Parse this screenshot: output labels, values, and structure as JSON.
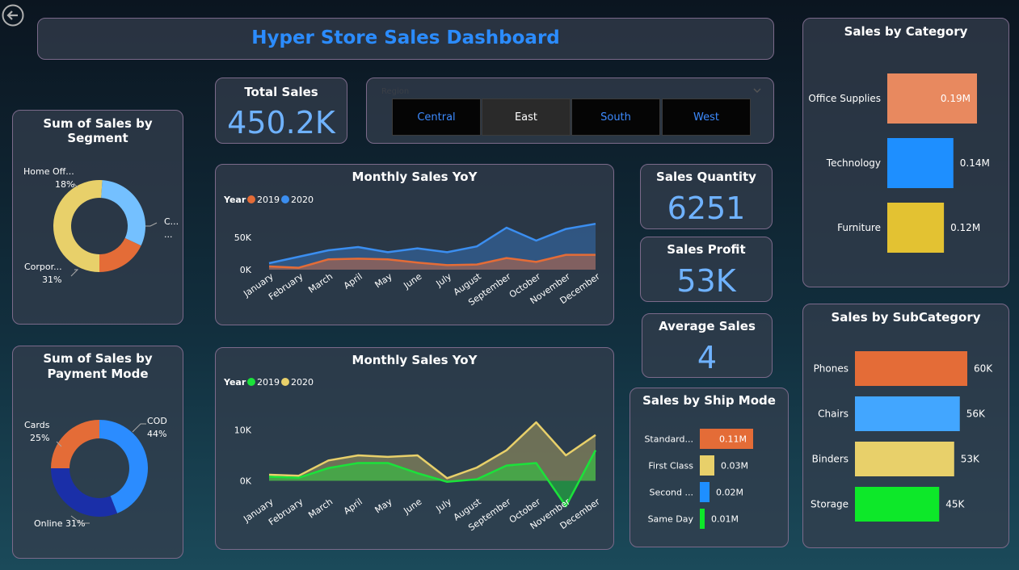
{
  "header": {
    "title": "Hyper Store Sales Dashboard"
  },
  "kpis": {
    "total_sales": {
      "label": "Total Sales",
      "value": "450.2K"
    },
    "quantity": {
      "label": "Sales Quantity",
      "value": "6251"
    },
    "profit": {
      "label": "Sales Profit",
      "value": "53K"
    },
    "avg": {
      "label": "Average Sales",
      "value": "4"
    }
  },
  "region_slicer": {
    "label": "Region",
    "options": [
      "Central",
      "East",
      "South",
      "West"
    ],
    "selected": "East"
  },
  "colors": {
    "orange": "#e46c37",
    "blue": "#3b8ef0",
    "yellow": "#e8d06a",
    "green": "#1be23a",
    "darkblue": "#1a2fa8",
    "lightblue": "#74c0ff",
    "accent": "#2b8cff"
  },
  "chart_data": [
    {
      "id": "segment",
      "type": "pie",
      "title": "Sum of Sales by Segment",
      "slices": [
        {
          "label": "C...",
          "value": 51,
          "pct_label": "...",
          "color": "#e8d06a"
        },
        {
          "label": "Corpor...",
          "value": 31,
          "pct_label": "31%",
          "color": "#74c0ff"
        },
        {
          "label": "Home Off...",
          "value": 18,
          "pct_label": "18%",
          "color": "#e46c37"
        }
      ]
    },
    {
      "id": "payment",
      "type": "pie",
      "title": "Sum of Sales by Payment Mode",
      "slices": [
        {
          "label": "COD",
          "value": 44,
          "pct_label": "44%",
          "color": "#2b8cff"
        },
        {
          "label": "Online",
          "value": 31,
          "pct_label": "31%",
          "color": "#1a2fa8"
        },
        {
          "label": "Cards",
          "value": 25,
          "pct_label": "25%",
          "color": "#e46c37"
        }
      ]
    },
    {
      "id": "yoy1",
      "type": "area",
      "title": "Monthly Sales YoY",
      "legend_title": "Year",
      "categories": [
        "January",
        "February",
        "March",
        "April",
        "May",
        "June",
        "July",
        "August",
        "September",
        "October",
        "November",
        "December"
      ],
      "yticks": [
        "0K",
        "50K"
      ],
      "ylim": [
        0,
        80000
      ],
      "series": [
        {
          "name": "2020",
          "color": "#3b8ef0",
          "values": [
            10000,
            20000,
            30000,
            35000,
            27000,
            33000,
            27000,
            36000,
            65000,
            45000,
            63000,
            71000
          ]
        },
        {
          "name": "2019",
          "color": "#e46c37",
          "values": [
            5000,
            3000,
            16000,
            17000,
            16000,
            11000,
            7000,
            8000,
            18000,
            12000,
            23000,
            23000
          ]
        }
      ]
    },
    {
      "id": "yoy2",
      "type": "area",
      "title": "Monthly Sales YoY",
      "legend_title": "Year",
      "categories": [
        "January",
        "February",
        "March",
        "April",
        "May",
        "June",
        "July",
        "August",
        "September",
        "October",
        "November",
        "December"
      ],
      "yticks": [
        "0K",
        "10K"
      ],
      "ylim": [
        -5000,
        15000
      ],
      "series": [
        {
          "name": "2020",
          "color": "#e8d06a",
          "values": [
            1200,
            1000,
            4000,
            5000,
            4700,
            5000,
            500,
            2600,
            6000,
            11500,
            5000,
            9000
          ]
        },
        {
          "name": "2019",
          "color": "#1be23a",
          "values": [
            800,
            600,
            2500,
            3500,
            3500,
            1500,
            -200,
            300,
            3000,
            3500,
            -5000,
            6000
          ]
        }
      ]
    },
    {
      "id": "category",
      "type": "bar",
      "title": "Sales by Category",
      "categories": [
        "Office Supplies",
        "Technology",
        "Furniture"
      ],
      "values": [
        0.19,
        0.14,
        0.12
      ],
      "labels": [
        "0.19M",
        "0.14M",
        "0.12M"
      ],
      "colors": [
        "#e8895f",
        "#1e8fff",
        "#e3c232"
      ],
      "ylim": [
        0,
        0.19
      ]
    },
    {
      "id": "subcategory",
      "type": "bar",
      "title": "Sales by SubCategory",
      "categories": [
        "Phones",
        "Chairs",
        "Binders",
        "Storage"
      ],
      "values": [
        60,
        56,
        53,
        45
      ],
      "labels": [
        "60K",
        "56K",
        "53K",
        "45K"
      ],
      "colors": [
        "#e46c37",
        "#42a6ff",
        "#e8d06a",
        "#0de829"
      ],
      "ylim": [
        0,
        60
      ]
    },
    {
      "id": "shipmode",
      "type": "bar",
      "title": "Sales by Ship Mode",
      "categories": [
        "Standard...",
        "First Class",
        "Second ...",
        "Same Day"
      ],
      "values": [
        0.11,
        0.03,
        0.02,
        0.01
      ],
      "labels": [
        "0.11M",
        "0.03M",
        "0.02M",
        "0.01M"
      ],
      "colors": [
        "#e46c37",
        "#e8d06a",
        "#1e8fff",
        "#0de829"
      ],
      "ylim": [
        0,
        0.11
      ]
    }
  ]
}
